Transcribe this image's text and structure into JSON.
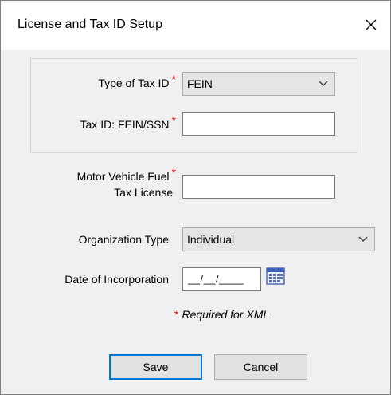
{
  "window": {
    "title": "License and Tax ID Setup"
  },
  "fields": {
    "tax_id_type": {
      "label": "Type of Tax ID",
      "value": "FEIN"
    },
    "tax_id": {
      "label": "Tax ID: FEIN/SSN",
      "value": ""
    },
    "fuel_license": {
      "label_line1": "Motor Vehicle Fuel",
      "label_line2": "Tax License",
      "value": ""
    },
    "org_type": {
      "label": "Organization Type",
      "value": "Individual"
    },
    "date_incorp": {
      "label": "Date of Incorporation",
      "value": "__/__/____"
    }
  },
  "required_marker": "*",
  "footnote": "Required for XML",
  "buttons": {
    "save": "Save",
    "cancel": "Cancel"
  },
  "colors": {
    "required": "#e00000",
    "focus_border": "#0078d7"
  }
}
